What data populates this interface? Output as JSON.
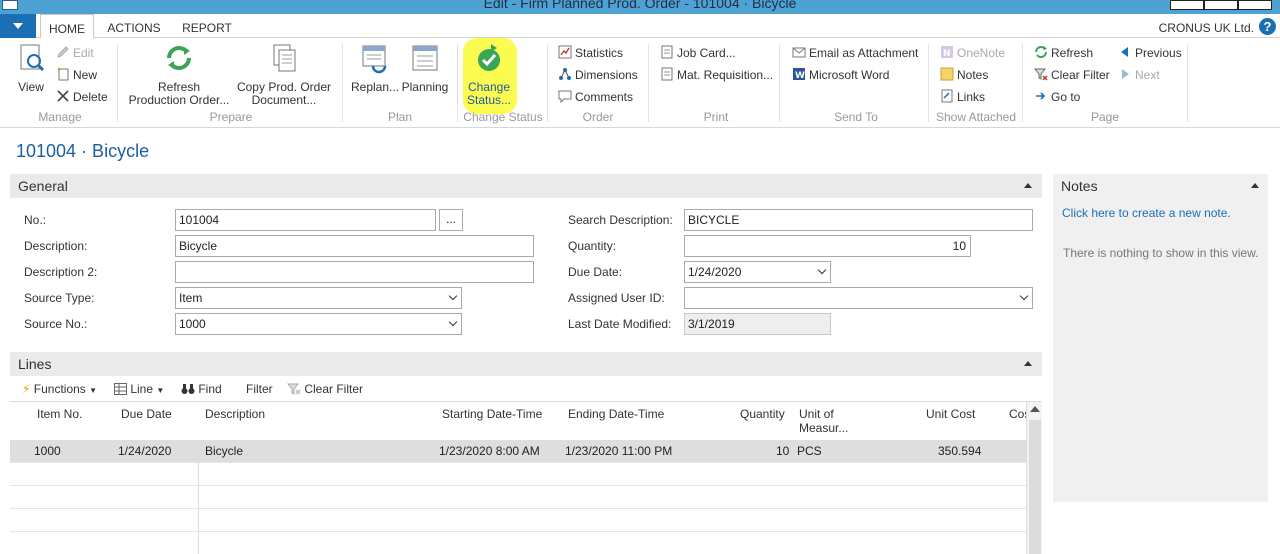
{
  "window": {
    "title": "Edit - Firm Planned Prod. Order - 101004 · Bicycle"
  },
  "tabs": [
    "HOME",
    "ACTIONS",
    "REPORT"
  ],
  "company": "CRONUS UK Ltd.",
  "help_label": "?",
  "ribbon": {
    "manage": {
      "label": "Manage",
      "view": "View",
      "edit": "Edit",
      "new": "New",
      "delete": "Delete"
    },
    "prepare": {
      "label": "Prepare",
      "refresh_line1": "Refresh",
      "refresh_line2": "Production Order...",
      "copy_line1": "Copy Prod. Order",
      "copy_line2": "Document..."
    },
    "plan": {
      "label": "Plan",
      "replan": "Replan...",
      "planning": "Planning"
    },
    "change_status": {
      "label": "Change Status",
      "btn_line1": "Change",
      "btn_line2": "Status..."
    },
    "order": {
      "label": "Order",
      "statistics": "Statistics",
      "dimensions": "Dimensions",
      "comments": "Comments"
    },
    "print": {
      "label": "Print",
      "job_card": "Job Card...",
      "mat_requisition": "Mat. Requisition..."
    },
    "send_to": {
      "label": "Send To",
      "email": "Email as Attachment",
      "word": "Microsoft Word"
    },
    "show_attached": {
      "label": "Show Attached",
      "onenote": "OneNote",
      "notes": "Notes",
      "links": "Links"
    },
    "page": {
      "label": "Page",
      "refresh": "Refresh",
      "clear_filter": "Clear Filter",
      "goto": "Go to",
      "previous": "Previous",
      "next": "Next"
    }
  },
  "page_title": "101004 · Bicycle",
  "general": {
    "header": "General",
    "no_label": "No.:",
    "no_value": "101004",
    "ellipsis": "...",
    "description_label": "Description:",
    "description_value": "Bicycle",
    "description2_label": "Description 2:",
    "description2_value": "",
    "source_type_label": "Source Type:",
    "source_type_value": "Item",
    "source_no_label": "Source No.:",
    "source_no_value": "1000",
    "search_desc_label": "Search Description:",
    "search_desc_value": "BICYCLE",
    "quantity_label": "Quantity:",
    "quantity_value": "10",
    "due_date_label": "Due Date:",
    "due_date_value": "1/24/2020",
    "assigned_user_label": "Assigned User ID:",
    "assigned_user_value": "",
    "last_modified_label": "Last Date Modified:",
    "last_modified_value": "3/1/2019"
  },
  "notes": {
    "header": "Notes",
    "create_link": "Click here to create a new note.",
    "empty": "There is nothing to show in this view."
  },
  "lines": {
    "header": "Lines",
    "toolbar": {
      "functions": "Functions",
      "line": "Line",
      "find": "Find",
      "filter": "Filter",
      "clear_filter": "Clear Filter"
    },
    "columns": {
      "item_no": "Item No.",
      "due_date": "Due Date",
      "description": "Description",
      "starting": "Starting Date-Time",
      "ending": "Ending Date-Time",
      "quantity": "Quantity",
      "uom_line1": "Unit of",
      "uom_line2": "Measur...",
      "unit_cost": "Unit Cost",
      "cost": "Cos"
    },
    "rows": [
      {
        "item_no": "1000",
        "due_date": "1/24/2020",
        "description": "Bicycle",
        "starting": "1/23/2020 8:00 AM",
        "ending": "1/23/2020 11:00 PM",
        "quantity": "10",
        "uom": "PCS",
        "unit_cost": "350.594"
      }
    ]
  },
  "colors": {
    "accent": "#1b6fb5",
    "highlight": "#fbfb50",
    "titlebar": "#4ea1d3"
  }
}
